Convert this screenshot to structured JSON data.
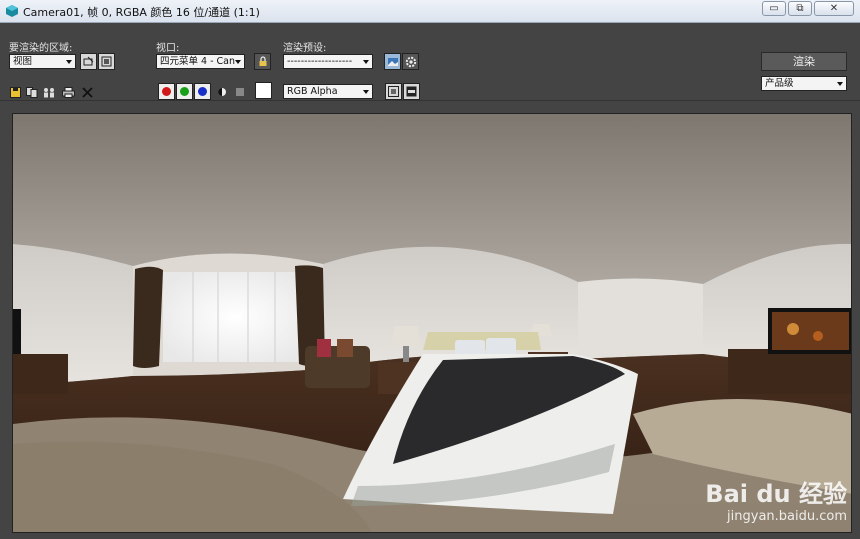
{
  "window": {
    "title": "Camera01, 帧 0, RGBA 颜色 16 位/通道 (1:1)",
    "minimize_glyph": "▭",
    "maximize_glyph": "⧉",
    "close_glyph": "✕"
  },
  "panel": {
    "area_label": "要渲染的区域:",
    "area_value": "视图",
    "viewport_label": "视口:",
    "viewport_value": "四元菜单 4 - Can",
    "preset_label": "渲染预设:",
    "preset_value": "-------------------",
    "render_button": "渲染",
    "quality_value": "产品级",
    "channel_value": "RGB Alpha"
  },
  "colors": {
    "channel_red": "#d01818",
    "channel_green": "#18a018",
    "channel_blue": "#1830c8"
  },
  "icons": [
    "save-icon",
    "copy-icon",
    "clone-icon",
    "print-icon",
    "clear-icon",
    "region-edit-icon",
    "region-auto-icon",
    "lock-icon",
    "environment-icon",
    "settings-icon",
    "mono-icon",
    "alpha-icon",
    "display-icon",
    "frame-icon"
  ],
  "watermark": {
    "brand": "Bai du 经验",
    "url": "jingyan.baidu.com"
  }
}
